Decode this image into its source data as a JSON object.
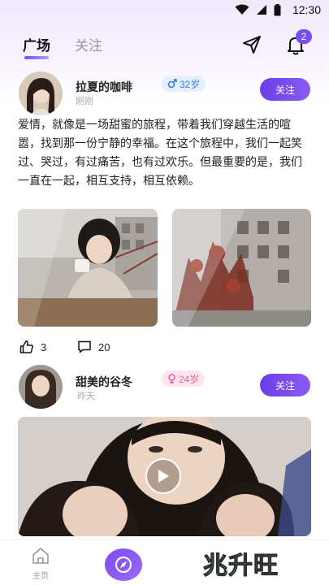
{
  "status_bar": {
    "time": "12:30"
  },
  "header": {
    "tabs": [
      {
        "label": "广场",
        "active": true
      },
      {
        "label": "关注",
        "active": false
      }
    ],
    "notification_count": "2"
  },
  "posts": [
    {
      "username": "拉夏的咖啡",
      "time": "刚刚",
      "gender": "male",
      "age": "32岁",
      "follow_label": "关注",
      "text": "爱情，就像是一场甜蜜的旅程，带着我们穿越生活的喧嚣，找到那一份宁静的幸福。在这个旅程中，我们一起笑过、哭过，有过痛苦，也有过欢乐。但最重要的是，我们一直在一起，相互支持，相互依赖。",
      "likes": "3",
      "comments": "20"
    },
    {
      "username": "甜美的谷冬",
      "time": "昨天",
      "gender": "female",
      "age": "24岁",
      "follow_label": "关注"
    }
  ],
  "bottom_nav": {
    "home_label": "主页",
    "brand_text": "兆升旺"
  },
  "colors": {
    "accent": "#7a4df2",
    "male": "#3d7ce0",
    "female": "#ef5e93"
  }
}
